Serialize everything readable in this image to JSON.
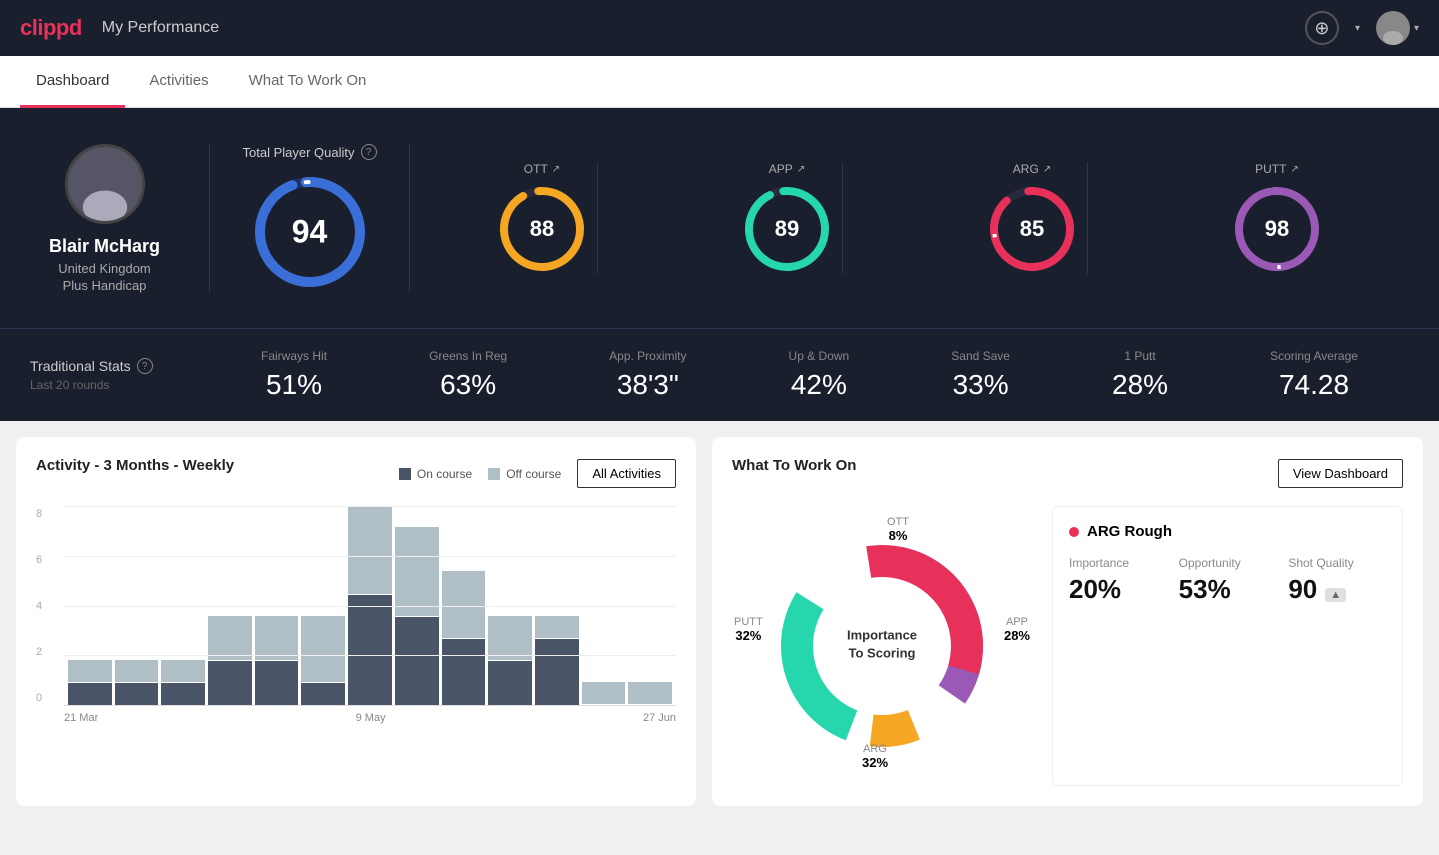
{
  "header": {
    "logo": "clippd",
    "title": "My Performance",
    "add_icon": "+",
    "chevron": "▾"
  },
  "nav": {
    "tabs": [
      {
        "label": "Dashboard",
        "active": true
      },
      {
        "label": "Activities",
        "active": false
      },
      {
        "label": "What To Work On",
        "active": false
      }
    ]
  },
  "profile": {
    "name": "Blair McHarg",
    "country": "United Kingdom",
    "handicap": "Plus Handicap"
  },
  "scores": {
    "total_label": "Total Player Quality",
    "total_value": "94",
    "sub": [
      {
        "label": "OTT",
        "value": "88",
        "color": "#f5a623",
        "trail": "#2a2a3e"
      },
      {
        "label": "APP",
        "value": "89",
        "color": "#26d7ae",
        "trail": "#2a2a3e"
      },
      {
        "label": "ARG",
        "value": "85",
        "color": "#e8315a",
        "trail": "#2a2a3e"
      },
      {
        "label": "PUTT",
        "value": "98",
        "color": "#9b59b6",
        "trail": "#2a2a3e"
      }
    ]
  },
  "trad_stats": {
    "title": "Traditional Stats",
    "subtitle": "Last 20 rounds",
    "items": [
      {
        "name": "Fairways Hit",
        "value": "51%"
      },
      {
        "name": "Greens In Reg",
        "value": "63%"
      },
      {
        "name": "App. Proximity",
        "value": "38'3\""
      },
      {
        "name": "Up & Down",
        "value": "42%"
      },
      {
        "name": "Sand Save",
        "value": "33%"
      },
      {
        "name": "1 Putt",
        "value": "28%"
      },
      {
        "name": "Scoring Average",
        "value": "74.28"
      }
    ]
  },
  "activity_chart": {
    "title": "Activity - 3 Months - Weekly",
    "legend": {
      "on_course": "On course",
      "off_course": "Off course"
    },
    "all_activities_btn": "All Activities",
    "x_labels": [
      "21 Mar",
      "9 May",
      "27 Jun"
    ],
    "y_labels": [
      "0",
      "2",
      "4",
      "6",
      "8"
    ],
    "bars": [
      {
        "on": 1,
        "off": 1
      },
      {
        "on": 1,
        "off": 1
      },
      {
        "on": 1,
        "off": 1
      },
      {
        "on": 2,
        "off": 2
      },
      {
        "on": 2,
        "off": 2
      },
      {
        "on": 1,
        "off": 3
      },
      {
        "on": 5,
        "off": 4
      },
      {
        "on": 4,
        "off": 4
      },
      {
        "on": 3,
        "off": 3
      },
      {
        "on": 2,
        "off": 2
      },
      {
        "on": 3,
        "off": 1
      },
      {
        "on": 0,
        "off": 1
      },
      {
        "on": 0,
        "off": 1
      }
    ]
  },
  "what_to_work_on": {
    "title": "What To Work On",
    "view_dashboard_btn": "View Dashboard",
    "donut": {
      "center_line1": "Importance",
      "center_line2": "To Scoring",
      "segments": [
        {
          "label": "OTT",
          "percent": "8%",
          "color": "#f5a623"
        },
        {
          "label": "APP",
          "percent": "28%",
          "color": "#26d7ae"
        },
        {
          "label": "ARG",
          "percent": "32%",
          "color": "#e8315a"
        },
        {
          "label": "PUTT",
          "percent": "32%",
          "color": "#9b59b6"
        }
      ]
    },
    "detail_card": {
      "title": "ARG Rough",
      "metrics": [
        {
          "label": "Importance",
          "value": "20%"
        },
        {
          "label": "Opportunity",
          "value": "53%"
        },
        {
          "label": "Shot Quality",
          "value": "90",
          "badge": ""
        }
      ]
    }
  }
}
